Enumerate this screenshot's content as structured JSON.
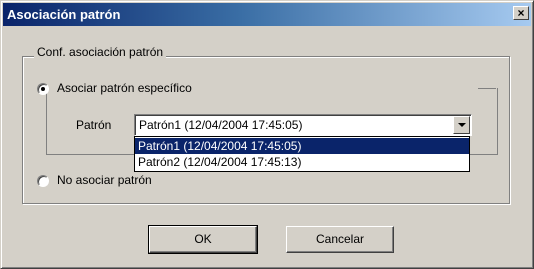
{
  "window": {
    "title": "Asociación patrón",
    "close_label": "×"
  },
  "group": {
    "legend": "Conf. asociación patrón"
  },
  "option_specific": {
    "label": "Asociar patrón específico",
    "selected": true
  },
  "pattern": {
    "label": "Patrón",
    "selected_value": "Patrón1 (12/04/2004 17:45:05)",
    "options": [
      "Patrón1 (12/04/2004 17:45:05)",
      "Patrón2 (12/04/2004 17:45:13)"
    ]
  },
  "option_none": {
    "label": "No asociar patrón",
    "selected": false
  },
  "buttons": {
    "ok": "OK",
    "cancel": "Cancelar"
  },
  "colors": {
    "title_start": "#0a246a",
    "title_end": "#a6caf0",
    "selection": "#0a246a",
    "face": "#d4d0c8"
  }
}
